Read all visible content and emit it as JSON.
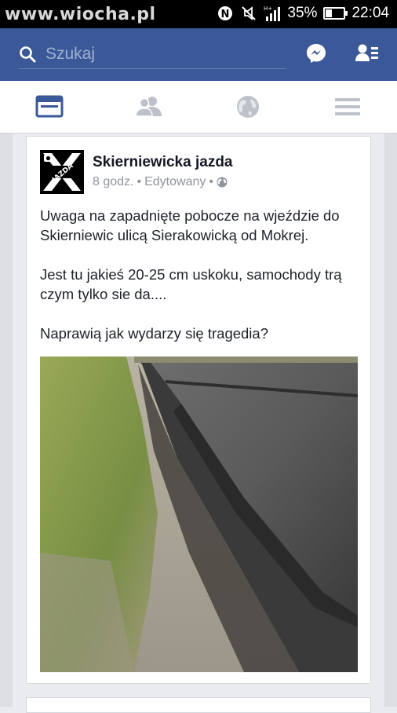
{
  "statusbar": {
    "watermark": "www.wiocha.pl",
    "battery": "35%",
    "battery_level": 0.35,
    "time": "22:04",
    "icons": [
      "nfc-icon",
      "mute-icon",
      "signal-icon",
      "battery-icon"
    ]
  },
  "fbbar": {
    "search_placeholder": "Szukaj",
    "icons": [
      "search-icon",
      "messenger-icon",
      "friend-requests-icon"
    ],
    "color": "#3b5998"
  },
  "navtabs": [
    "news-feed-icon",
    "friends-icon",
    "globe-icon",
    "menu-icon"
  ],
  "post": {
    "page_name": "Skierniewicka jazda",
    "time": "8 godz.",
    "edited": "Edytowany",
    "separator": "•",
    "paragraphs": [
      "Uwaga na zapadnięte pobocze na wjeździe do Skierniewic ulicą Sierakowicką od Mokrej.",
      "Jest tu jakieś 20-25 cm uskoku, samochody trą czym tylko sie da....",
      "Naprawią jak wydarzy się tragedia?"
    ],
    "avatar_text": "JAZDA",
    "avatar_small_text": "Skierniewicka"
  }
}
